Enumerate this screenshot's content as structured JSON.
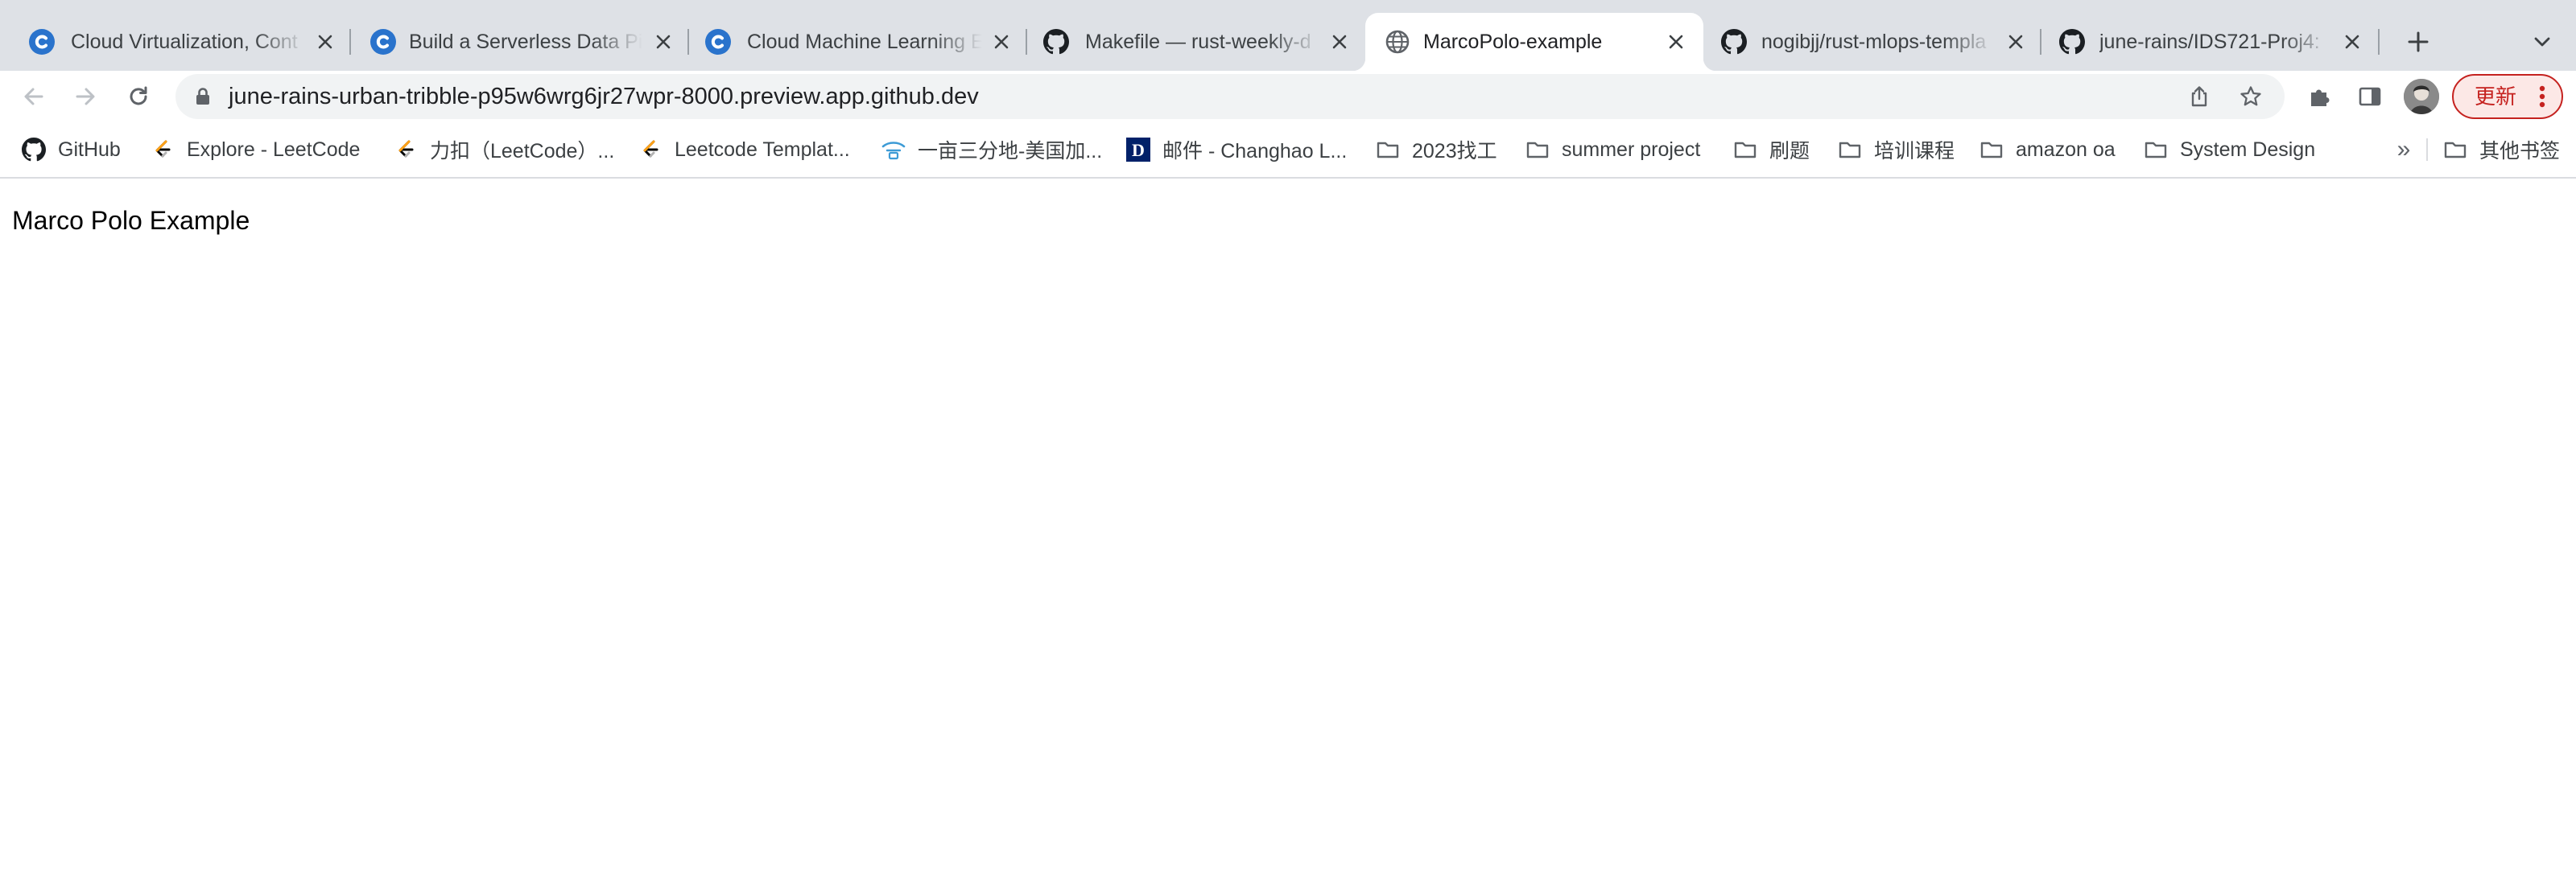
{
  "colors": {
    "tabstrip_bg": "#dee1e6",
    "active_tab_bg": "#ffffff",
    "omnibox_bg": "#f1f3f4",
    "update_accent": "#c5221f",
    "coursera_blue": "#2a73cc",
    "folder_gray": "#5f6368"
  },
  "tabs": [
    {
      "title": "Cloud Virtualization, Cont",
      "icon": "coursera-icon",
      "active": false
    },
    {
      "title": "Build a Serverless Data Pi",
      "icon": "coursera-icon",
      "active": false
    },
    {
      "title": "Cloud Machine Learning E",
      "icon": "coursera-icon",
      "active": false
    },
    {
      "title": "Makefile — rust-weekly-d",
      "icon": "github-icon",
      "active": false
    },
    {
      "title": "MarcoPolo-example",
      "icon": "globe-icon",
      "active": true
    },
    {
      "title": "nogibjj/rust-mlops-templa",
      "icon": "github-icon",
      "active": false
    },
    {
      "title": "june-rains/IDS721-Proj4: ",
      "icon": "github-icon",
      "active": false
    }
  ],
  "toolbar": {
    "url": "june-rains-urban-tribble-p95w6wrg6jr27wpr-8000.preview.app.github.dev",
    "update_label": "更新"
  },
  "bookmarks": {
    "items": [
      {
        "label": "GitHub",
        "icon": "github-icon"
      },
      {
        "label": "Explore - LeetCode",
        "icon": "leetcode-icon"
      },
      {
        "label": "力扣（LeetCode）...",
        "icon": "leetcode-icon"
      },
      {
        "label": "Leetcode Templat...",
        "icon": "leetcode-icon"
      },
      {
        "label": "一亩三分地-美国加...",
        "icon": "yimu-icon"
      },
      {
        "label": "邮件 - Changhao L...",
        "icon": "duke-d-icon"
      },
      {
        "label": "2023找工",
        "icon": "folder-icon"
      },
      {
        "label": "summer project",
        "icon": "folder-icon"
      },
      {
        "label": "刷题",
        "icon": "folder-icon"
      },
      {
        "label": "培训课程",
        "icon": "folder-icon"
      },
      {
        "label": "amazon oa",
        "icon": "folder-icon"
      },
      {
        "label": "System Design",
        "icon": "folder-icon"
      }
    ],
    "overflow_label": "»",
    "other_label": "其他书签"
  },
  "page": {
    "heading": "Marco Polo Example"
  }
}
